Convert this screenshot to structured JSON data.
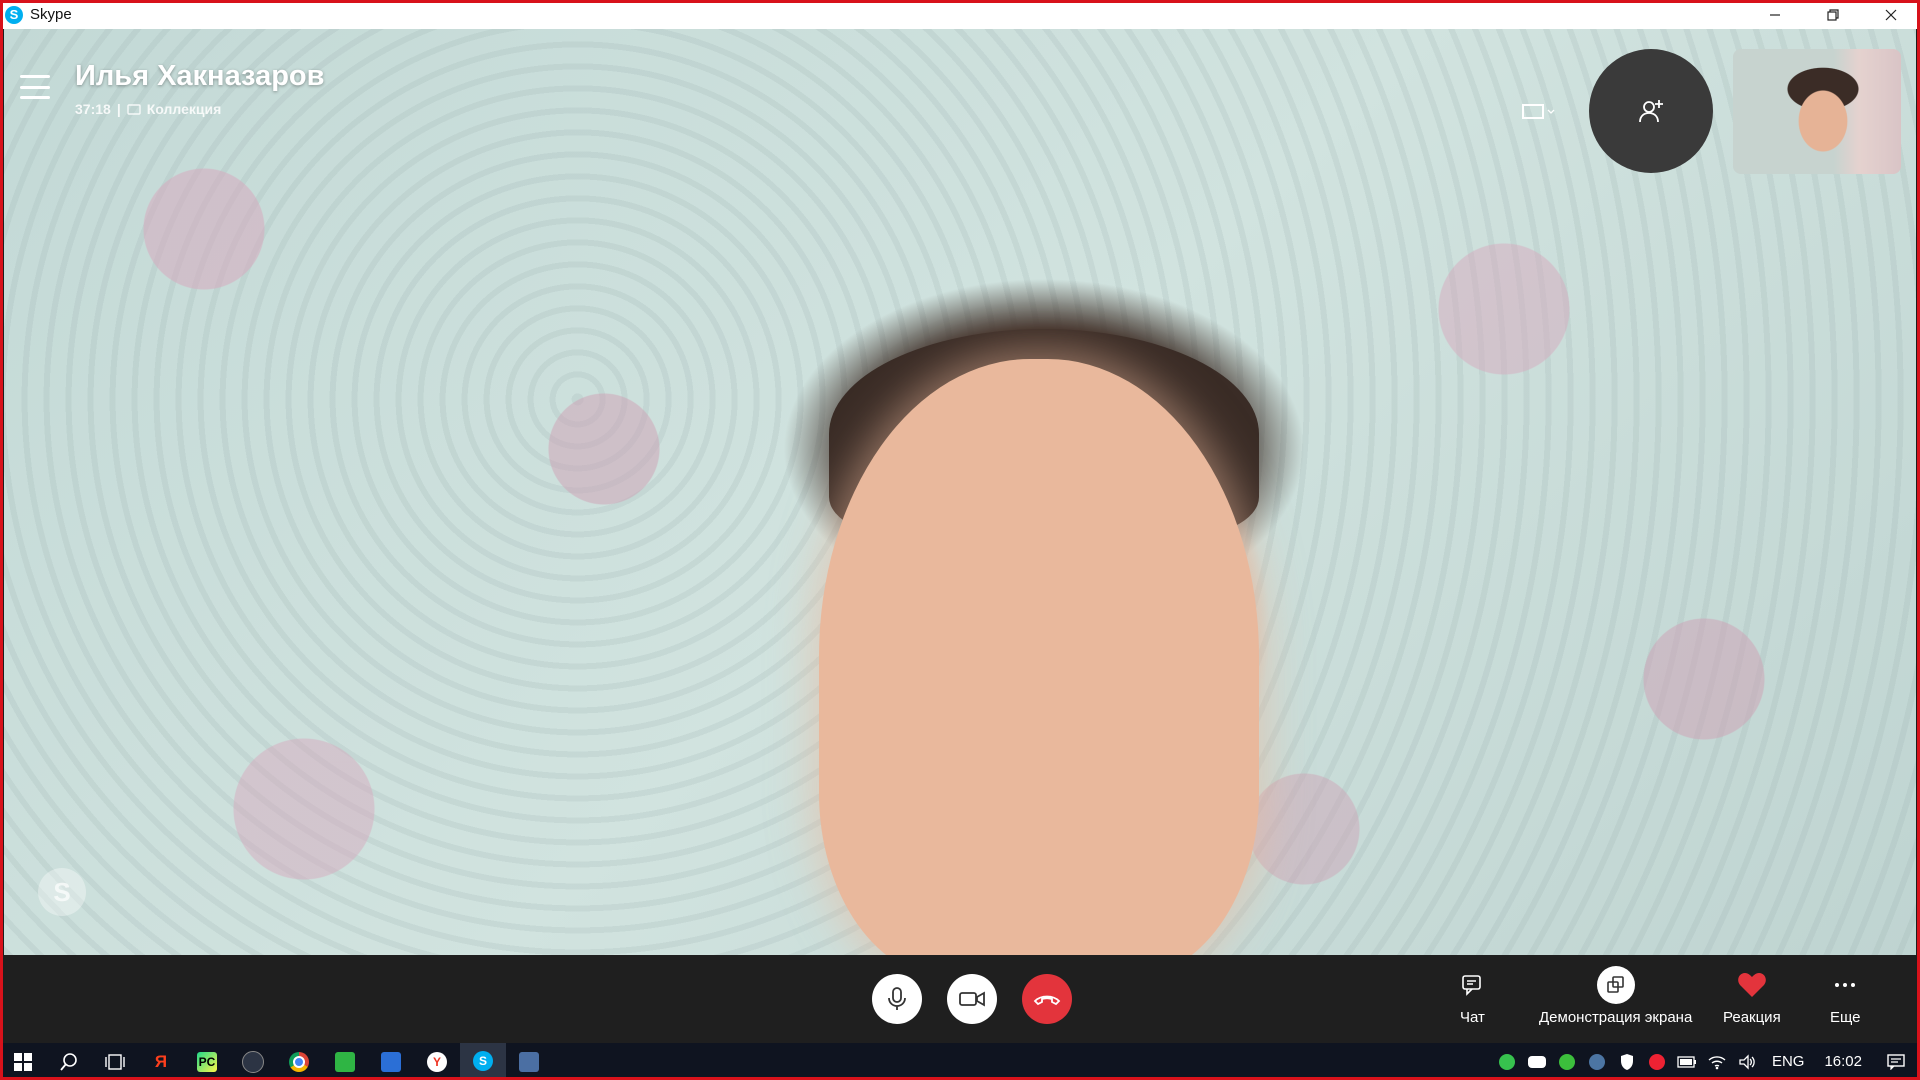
{
  "window": {
    "title": "Skype",
    "app_icon": "skype-logo-icon"
  },
  "call": {
    "contact_name": "Илья Хакназаров",
    "duration": "37:18",
    "separator": "|",
    "gallery_label": "Коллекция"
  },
  "controls": {
    "chat_label": "Чат",
    "share_label": "Демонстрация экрана",
    "reaction_label": "Реакция",
    "more_label": "Еще"
  },
  "taskbar": {
    "language": "ENG",
    "time": "16:02",
    "pinned_apps": [
      "windows-start-icon",
      "search-icon",
      "task-view-icon",
      "yandex-icon",
      "pycharm-icon",
      "app-icon",
      "chrome-icon",
      "app-green-icon",
      "app-blue-icon",
      "yandex-browser-icon",
      "skype-icon",
      "app-folder-icon"
    ]
  },
  "colors": {
    "accent_red": "#e3343c",
    "window_border": "#d8121b",
    "taskbar": "#0f1420",
    "control_bar": "#1f1f1f"
  }
}
